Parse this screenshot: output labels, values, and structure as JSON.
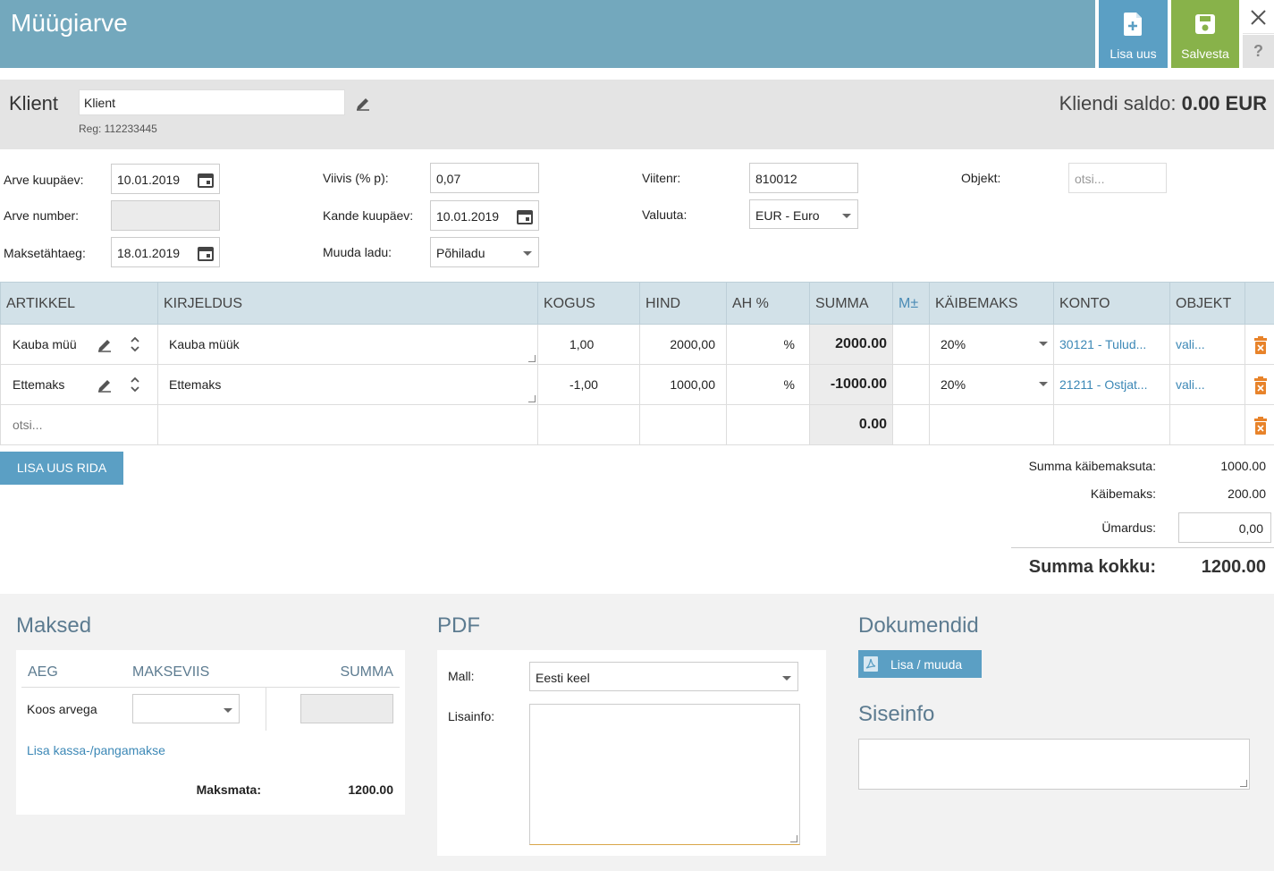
{
  "header": {
    "title": "Müügiarve",
    "new_label": "Lisa uus",
    "save_label": "Salvesta",
    "help_label": "?"
  },
  "client": {
    "label": "Klient",
    "value": "Klient",
    "reg": "Reg: 112233445",
    "saldo_label": "Kliendi saldo:",
    "saldo_value": "0.00 EUR"
  },
  "form": {
    "invoice_date_label": "Arve kuupäev:",
    "invoice_date": "10.01.2019",
    "invoice_number_label": "Arve number:",
    "invoice_number": "",
    "due_date_label": "Maksetähtaeg:",
    "due_date": "18.01.2019",
    "penalty_label": "Viivis (% p):",
    "penalty": "0,07",
    "entry_date_label": "Kande kuupäev:",
    "entry_date": "10.01.2019",
    "warehouse_label": "Muuda ladu:",
    "warehouse": "Põhiladu",
    "ref_label": "Viitenr:",
    "ref": "810012",
    "currency_label": "Valuuta:",
    "currency": "EUR - Euro",
    "object_label": "Objekt:",
    "object_placeholder": "otsi..."
  },
  "table": {
    "headers": [
      "ARTIKKEL",
      "KIRJELDUS",
      "KOGUS",
      "HIND",
      "AH %",
      "SUMMA",
      "M±",
      "KÄIBEMAKS",
      "KONTO",
      "OBJEKT"
    ],
    "rows": [
      {
        "article": "Kauba müü",
        "description": "Kauba müük",
        "qty": "1,00",
        "price": "2000,00",
        "disc": "%",
        "sum": "2000.00",
        "vat": "20%",
        "account": "30121 - Tulud...",
        "object": "vali..."
      },
      {
        "article": "Ettemaks",
        "description": "Ettemaks",
        "qty": "-1,00",
        "price": "1000,00",
        "disc": "%",
        "sum": "-1000.00",
        "vat": "20%",
        "account": "21211 - Ostjat...",
        "object": "vali..."
      }
    ],
    "empty_row": {
      "article_placeholder": "otsi...",
      "sum": "0.00"
    },
    "add_row_label": "LISA UUS RIDA"
  },
  "totals": {
    "net_label": "Summa käibemaksuta:",
    "net": "1000.00",
    "vat_label": "Käibemaks:",
    "vat": "200.00",
    "rounding_label": "Ümardus:",
    "rounding": "0,00",
    "total_label": "Summa kokku:",
    "total": "1200.00"
  },
  "payments": {
    "title": "Maksed",
    "col_time": "AEG",
    "col_method": "MAKSEVIIS",
    "col_sum": "SUMMA",
    "row_label": "Koos arvega",
    "add_link": "Lisa kassa-/pangamakse",
    "unpaid_label": "Maksmata:",
    "unpaid": "1200.00"
  },
  "pdf": {
    "title": "PDF",
    "template_label": "Mall:",
    "template": "Eesti keel",
    "extra_label": "Lisainfo:"
  },
  "documents": {
    "title": "Dokumendid",
    "button_label": "Lisa / muuda"
  },
  "internal": {
    "title": "Siseinfo"
  },
  "colors": {
    "header": "#73a8bd",
    "new_button": "#5b9fc4",
    "save_button": "#88b24a",
    "trash": "#e8832a",
    "link": "#3c88b6"
  }
}
